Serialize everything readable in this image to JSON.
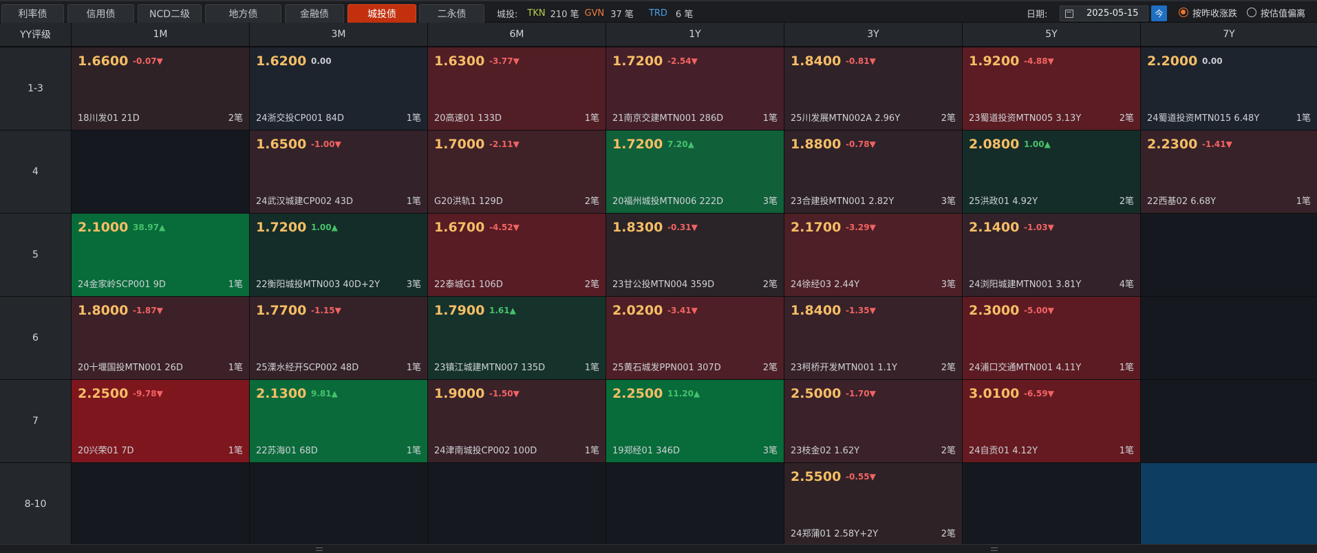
{
  "tabs": [
    {
      "label": "利率债",
      "active": false
    },
    {
      "label": "信用债",
      "active": false
    },
    {
      "label": "NCD二级",
      "active": false
    },
    {
      "label": "地方债",
      "active": false
    },
    {
      "label": "金融债",
      "active": false
    },
    {
      "label": "城投债",
      "active": true
    },
    {
      "label": "二永债",
      "active": false
    }
  ],
  "stats": {
    "label": "城投:",
    "tkn_label": "TKN",
    "tkn_value": "210 笔",
    "gvn_label": "GVN",
    "gvn_value": "37 笔",
    "trd_label": "TRD",
    "trd_value": "6 笔"
  },
  "date": {
    "label": "日期:",
    "value": "2025-05-15",
    "today_label": "今"
  },
  "options": {
    "opt1": "按昨收涨跌",
    "opt2": "按估值偏离",
    "selected": "opt1"
  },
  "grid": {
    "corner": "YY评级",
    "columns": [
      "1M",
      "3M",
      "6M",
      "1Y",
      "3Y",
      "5Y",
      "7Y"
    ],
    "rows": [
      {
        "rating": "1-3",
        "cells": [
          {
            "yield": "1.6600",
            "change": "-0.07▼",
            "dir": "down",
            "bond": "18川发01 21D",
            "count": "2笔",
            "color": "#2e2226"
          },
          {
            "yield": "1.6200",
            "change": "0.00",
            "dir": "flat",
            "bond": "24浙交投CP001 84D",
            "count": "1笔",
            "color": "#1d242d"
          },
          {
            "yield": "1.6300",
            "change": "-3.77▼",
            "dir": "down",
            "bond": "20高速01 133D",
            "count": "1笔",
            "color": "#521e25"
          },
          {
            "yield": "1.7200",
            "change": "-2.54▼",
            "dir": "down",
            "bond": "21南京交建MTN001 286D",
            "count": "1笔",
            "color": "#45202a"
          },
          {
            "yield": "1.8400",
            "change": "-0.81▼",
            "dir": "down",
            "bond": "25川发展MTN002A 2.96Y",
            "count": "2笔",
            "color": "#2f2228"
          },
          {
            "yield": "1.9200",
            "change": "-4.88▼",
            "dir": "down",
            "bond": "23蜀道投资MTN005 3.13Y",
            "count": "2笔",
            "color": "#5b1c23"
          },
          {
            "yield": "2.2000",
            "change": "0.00",
            "dir": "flat",
            "bond": "24蜀道投资MTN015 6.48Y",
            "count": "1笔",
            "color": "#1d242d"
          }
        ]
      },
      {
        "rating": "4",
        "cells": [
          null,
          {
            "yield": "1.6500",
            "change": "-1.00▼",
            "dir": "down",
            "bond": "24武汉城建CP002 43D",
            "count": "1笔",
            "color": "#33222a"
          },
          {
            "yield": "1.7000",
            "change": "-2.11▼",
            "dir": "down",
            "bond": "G20洪轨1 129D",
            "count": "2笔",
            "color": "#3f2128"
          },
          {
            "yield": "1.7200",
            "change": "7.20▲",
            "dir": "up",
            "bond": "20福州城投MTN006 222D",
            "count": "3笔",
            "color": "#10603a"
          },
          {
            "yield": "1.8800",
            "change": "-0.78▼",
            "dir": "down",
            "bond": "23合建投MTN001 2.82Y",
            "count": "3笔",
            "color": "#2f2228"
          },
          {
            "yield": "2.0800",
            "change": "1.00▲",
            "dir": "up",
            "bond": "25洪政01 4.92Y",
            "count": "2笔",
            "color": "#152d28"
          },
          {
            "yield": "2.2300",
            "change": "-1.41▼",
            "dir": "down",
            "bond": "22西基02 6.68Y",
            "count": "1笔",
            "color": "#372229"
          }
        ]
      },
      {
        "rating": "5",
        "cells": [
          {
            "yield": "2.1000",
            "change": "38.97▲",
            "dir": "up",
            "bond": "24金家岭SCP001 9D",
            "count": "1笔",
            "color": "#086b3a"
          },
          {
            "yield": "1.7200",
            "change": "1.00▲",
            "dir": "up",
            "bond": "22衡阳城投MTN003 40D+2Y",
            "count": "3笔",
            "color": "#152d28"
          },
          {
            "yield": "1.6700",
            "change": "-4.52▼",
            "dir": "down",
            "bond": "22泰城G1 106D",
            "count": "2笔",
            "color": "#581c24"
          },
          {
            "yield": "1.8300",
            "change": "-0.31▼",
            "dir": "down",
            "bond": "23甘公投MTN004 359D",
            "count": "2笔",
            "color": "#2a2328"
          },
          {
            "yield": "2.1700",
            "change": "-3.29▼",
            "dir": "down",
            "bond": "24徐经03 2.44Y",
            "count": "3笔",
            "color": "#4d1f26"
          },
          {
            "yield": "2.1400",
            "change": "-1.03▼",
            "dir": "down",
            "bond": "24浏阳城建MTN001 3.81Y",
            "count": "4笔",
            "color": "#33222a"
          },
          null
        ]
      },
      {
        "rating": "6",
        "cells": [
          {
            "yield": "1.8000",
            "change": "-1.87▼",
            "dir": "down",
            "bond": "20十堰国投MTN001 26D",
            "count": "1笔",
            "color": "#3d2128"
          },
          {
            "yield": "1.7700",
            "change": "-1.15▼",
            "dir": "down",
            "bond": "25溧水经开SCP002 48D",
            "count": "1笔",
            "color": "#352229"
          },
          {
            "yield": "1.7900",
            "change": "1.61▲",
            "dir": "up",
            "bond": "23镇江城建MTN007 135D",
            "count": "1笔",
            "color": "#16332b"
          },
          {
            "yield": "2.0200",
            "change": "-3.41▼",
            "dir": "down",
            "bond": "25黄石城发PPN001 307D",
            "count": "2笔",
            "color": "#4e1f26"
          },
          {
            "yield": "1.8400",
            "change": "-1.35▼",
            "dir": "down",
            "bond": "23柯桥开发MTN001 1.1Y",
            "count": "2笔",
            "color": "#372229"
          },
          {
            "yield": "2.3000",
            "change": "-5.00▼",
            "dir": "down",
            "bond": "24浦口交通MTN001 4.11Y",
            "count": "1笔",
            "color": "#5c1b22"
          },
          null
        ]
      },
      {
        "rating": "7",
        "cells": [
          {
            "yield": "2.2500",
            "change": "-9.78▼",
            "dir": "down",
            "bond": "20兴荣01 7D",
            "count": "1笔",
            "color": "#7e161e"
          },
          {
            "yield": "2.1300",
            "change": "9.81▲",
            "dir": "up",
            "bond": "22苏海01 68D",
            "count": "1笔",
            "color": "#0a6a3a"
          },
          {
            "yield": "1.9000",
            "change": "-1.50▼",
            "dir": "down",
            "bond": "24津南城投CP002 100D",
            "count": "1笔",
            "color": "#3a2229"
          },
          {
            "yield": "2.2500",
            "change": "11.20▲",
            "dir": "up",
            "bond": "19郑经01 346D",
            "count": "3笔",
            "color": "#086b3a"
          },
          {
            "yield": "2.5000",
            "change": "-1.70▼",
            "dir": "down",
            "bond": "23枝金02 1.62Y",
            "count": "2笔",
            "color": "#3b2129"
          },
          {
            "yield": "3.0100",
            "change": "-6.59▼",
            "dir": "down",
            "bond": "24自贡01 4.12Y",
            "count": "1笔",
            "color": "#651a21"
          },
          null
        ]
      },
      {
        "rating": "8-10",
        "cells": [
          null,
          null,
          null,
          null,
          {
            "yield": "2.5500",
            "change": "-0.55▼",
            "dir": "down",
            "bond": "24郑蒲01 2.58Y+2Y",
            "count": "2笔",
            "color": "#2e2226"
          },
          null,
          {
            "highlight": true,
            "color": "#0d3d60"
          }
        ]
      }
    ]
  },
  "colors": {
    "empty_cell": "#15191f",
    "accent": "#c2300e",
    "yield": "#f6be66",
    "down": "#f26363",
    "up": "#46c26c"
  }
}
